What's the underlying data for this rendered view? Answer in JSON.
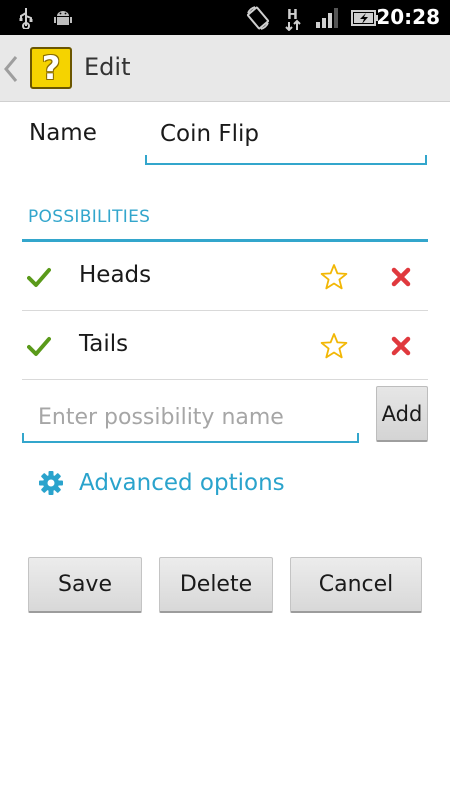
{
  "status_bar": {
    "time": "20:28",
    "icons": [
      "usb-icon",
      "android-debug-icon",
      "screen-rotate-icon",
      "hspa-data-icon",
      "signal-icon",
      "battery-charging-icon"
    ]
  },
  "action_bar": {
    "title": "Edit",
    "app_icon_glyph": "?",
    "colors": {
      "icon_bg": "#f5d300"
    }
  },
  "form": {
    "name_label": "Name",
    "name_value": "Coin Flip"
  },
  "possibilities": {
    "header": "POSSIBILITIES",
    "items": [
      {
        "label": "Heads",
        "enabled": true,
        "starred": false
      },
      {
        "label": "Tails",
        "enabled": true,
        "starred": false
      }
    ],
    "input_placeholder": "Enter possibility name",
    "input_value": "",
    "add_label": "Add"
  },
  "advanced": {
    "label": "Advanced options"
  },
  "buttons": {
    "save": "Save",
    "delete": "Delete",
    "cancel": "Cancel"
  },
  "colors": {
    "accent": "#33a6cc",
    "check": "#5a9a1a",
    "star": "#f2b705",
    "delete": "#e0393e"
  }
}
